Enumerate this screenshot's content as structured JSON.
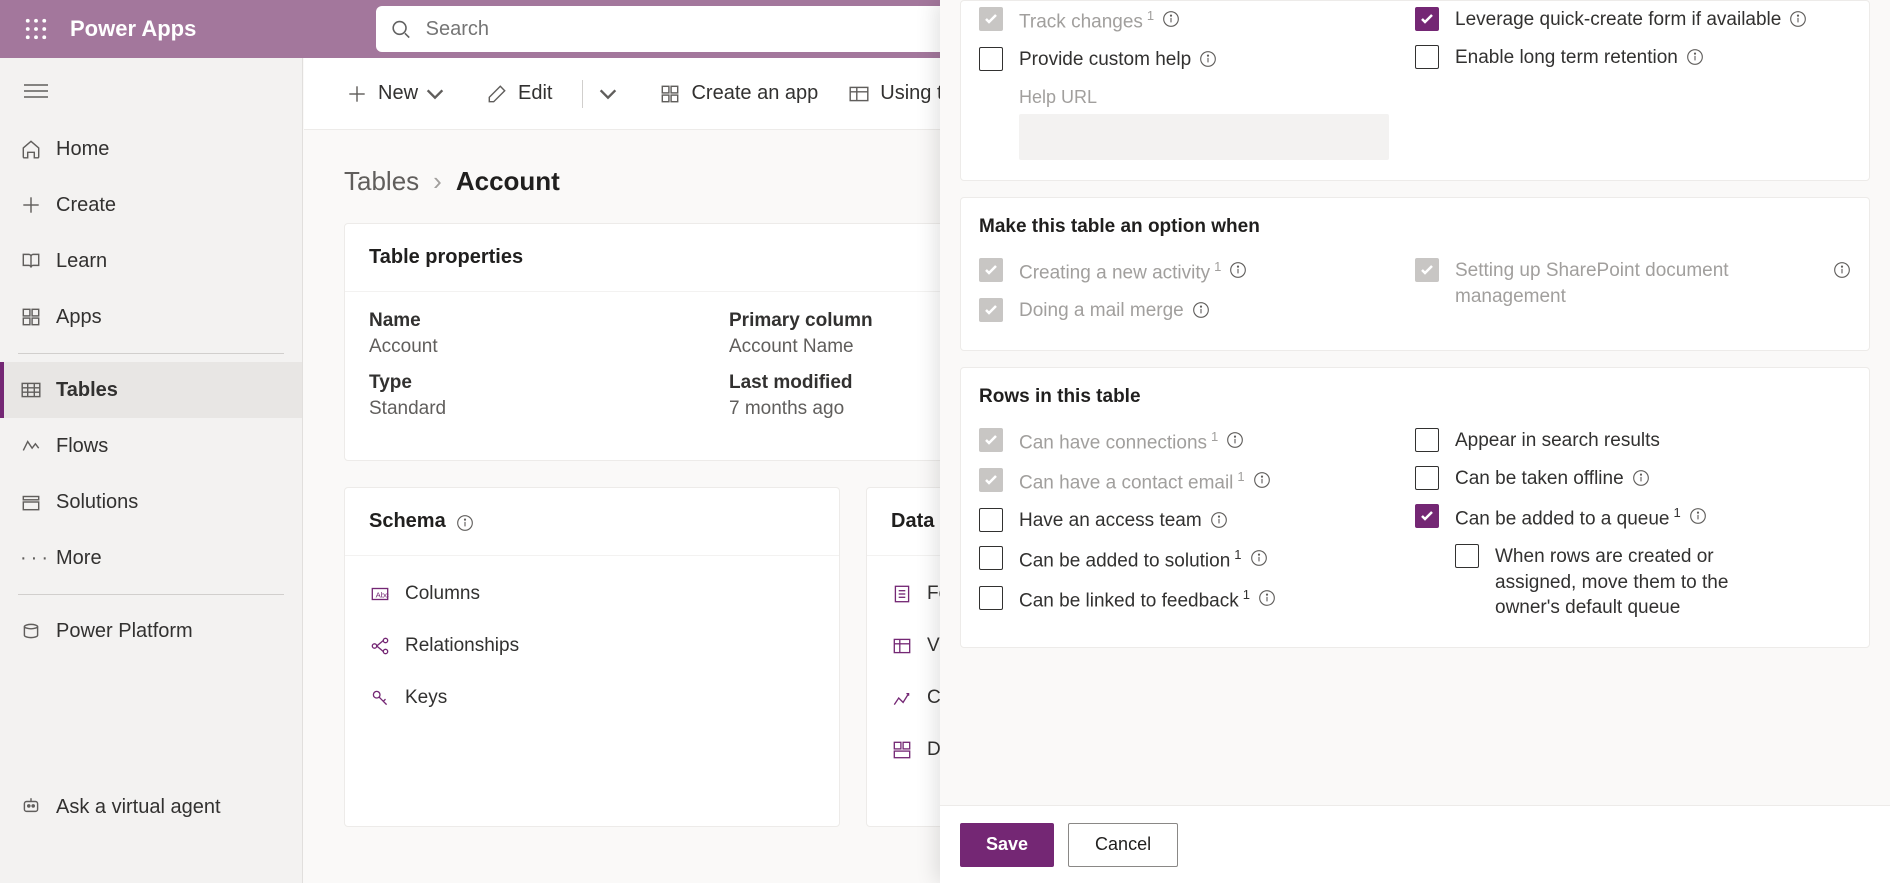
{
  "header": {
    "brand": "Power Apps",
    "search_placeholder": "Search"
  },
  "nav": {
    "home": "Home",
    "create": "Create",
    "learn": "Learn",
    "apps": "Apps",
    "tables": "Tables",
    "flows": "Flows",
    "solutions": "Solutions",
    "more": "More",
    "power_platform": "Power Platform",
    "ask_agent": "Ask a virtual agent"
  },
  "toolbar": {
    "new": "New",
    "edit": "Edit",
    "create_app": "Create an app",
    "using_this": "Using this t"
  },
  "breadcrumb": {
    "root": "Tables",
    "current": "Account"
  },
  "props_card": {
    "title": "Table properties",
    "name_label": "Name",
    "name_value": "Account",
    "type_label": "Type",
    "type_value": "Standard",
    "primary_label": "Primary column",
    "primary_value": "Account Name",
    "modified_label": "Last modified",
    "modified_value": "7 months ago"
  },
  "schema_tile": {
    "title": "Schema",
    "columns": "Columns",
    "relationships": "Relationships",
    "keys": "Keys"
  },
  "data_tile": {
    "title": "Data ex",
    "forms": "Fo",
    "views": "Vie",
    "charts": "Ch",
    "dashboards": "Das"
  },
  "panel": {
    "sec1": {
      "track_changes": "Track changes",
      "custom_help": "Provide custom help",
      "help_url": "Help URL",
      "quick_create": "Leverage quick-create form if available",
      "retention": "Enable long term retention"
    },
    "sec2": {
      "title": "Make this table an option when",
      "new_activity": "Creating a new activity",
      "mail_merge": "Doing a mail merge",
      "sharepoint": "Setting up SharePoint document management"
    },
    "sec3": {
      "title": "Rows in this table",
      "connections": "Can have connections",
      "contact_email": "Can have a contact email",
      "access_team": "Have an access team",
      "added_solution": "Can be added to solution",
      "linked_feedback": "Can be linked to feedback",
      "search_results": "Appear in search results",
      "offline": "Can be taken offline",
      "queue": "Can be added to a queue",
      "queue_sub": "When rows are created or assigned, move them to the owner's default queue"
    },
    "save": "Save",
    "cancel": "Cancel"
  }
}
